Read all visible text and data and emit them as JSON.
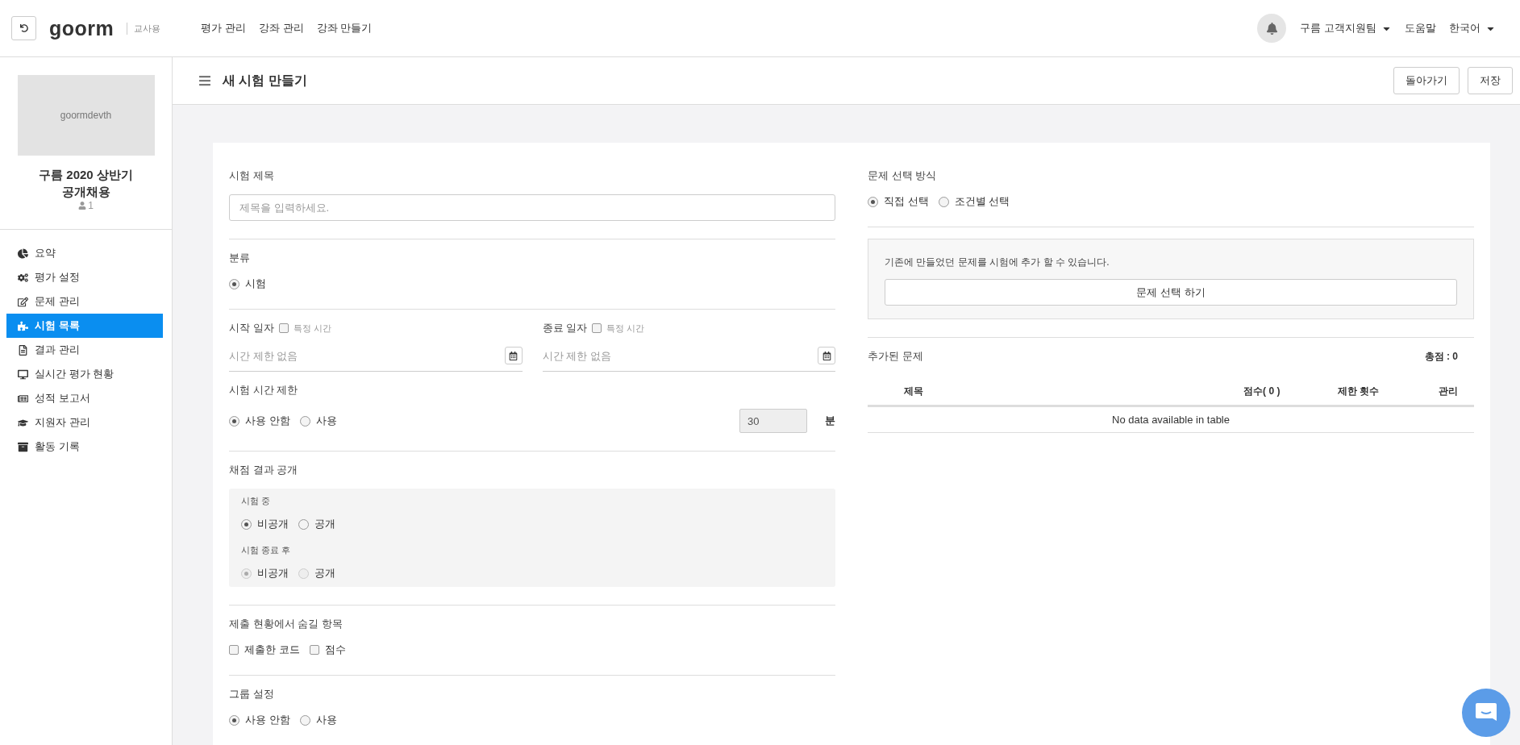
{
  "topbar": {
    "logo": "goorm",
    "role": "교사용",
    "nav": [
      "평가 관리",
      "강좌 관리",
      "강좌 만들기"
    ],
    "user": "구름 고객지원팀",
    "help": "도움말",
    "language": "한국어"
  },
  "sidebar": {
    "image_text": "goormdevth",
    "course_title": "구름 2020 상반기 공개채용",
    "member_count": "1",
    "items": [
      {
        "label": "요약",
        "selected": false
      },
      {
        "label": "평가 설정",
        "selected": false
      },
      {
        "label": "문제 관리",
        "selected": false
      },
      {
        "label": "시험 목록",
        "selected": true
      },
      {
        "label": "결과 관리",
        "selected": false
      },
      {
        "label": "실시간 평가 현황",
        "selected": false
      },
      {
        "label": "성적 보고서",
        "selected": false
      },
      {
        "label": "지원자 관리",
        "selected": false
      },
      {
        "label": "활동 기록",
        "selected": false
      }
    ]
  },
  "header": {
    "title": "새 시험 만들기",
    "buttons": [
      "돌아가기",
      "저장"
    ]
  },
  "exam_title": {
    "label": "시험 제목",
    "placeholder": "제목을 입력하세요."
  },
  "category": {
    "label": "분류",
    "options": [
      {
        "label": "시험",
        "selected": true
      }
    ]
  },
  "dates": [
    {
      "label": "시작 일자",
      "checkbox_label": "특정 시간",
      "checked": false,
      "placeholder": "시간 제한 없음"
    },
    {
      "label": "종료 일자",
      "checkbox_label": "특정 시간",
      "checked": false,
      "placeholder": "시간 제한 없음"
    }
  ],
  "time_limit": {
    "label": "시험 시간 제한",
    "options": [
      {
        "label": "사용 안함",
        "selected": true
      },
      {
        "label": "사용",
        "selected": false
      }
    ],
    "value": "30",
    "disabled": true,
    "unit": "분"
  },
  "score_visibility": {
    "label": "채점 결과 공개",
    "groups": [
      {
        "label": "시험 중",
        "disabled": false,
        "options": [
          {
            "label": "비공개",
            "selected": true
          },
          {
            "label": "공개",
            "selected": false
          }
        ]
      },
      {
        "label": "시험 종료 후",
        "disabled": true,
        "options": [
          {
            "label": "비공개",
            "selected": true
          },
          {
            "label": "공개",
            "selected": false
          }
        ]
      }
    ]
  },
  "hidden_items": {
    "label": "제출 현황에서 숨길 항목",
    "options": [
      {
        "label": "제출한 코드",
        "checked": false
      },
      {
        "label": "점수",
        "checked": false
      }
    ]
  },
  "group_setting": {
    "label": "그룹 설정",
    "options": [
      {
        "label": "사용 안함",
        "selected": true
      },
      {
        "label": "사용",
        "selected": false
      }
    ]
  },
  "selection_method": {
    "label": "문제 선택 방식",
    "options": [
      {
        "label": "직접 선택",
        "selected": true
      },
      {
        "label": "조건별 선택",
        "selected": false
      }
    ]
  },
  "picker": {
    "text": "기존에 만들었던 문제를 시험에 추가 할 수 있습니다.",
    "button": "문제 선택 하기"
  },
  "added": {
    "label": "추가된 문제",
    "total": "총점 : 0",
    "columns": [
      "제목",
      "점수( 0 )",
      "제한 횟수",
      "관리"
    ],
    "empty": "No data available in table"
  }
}
